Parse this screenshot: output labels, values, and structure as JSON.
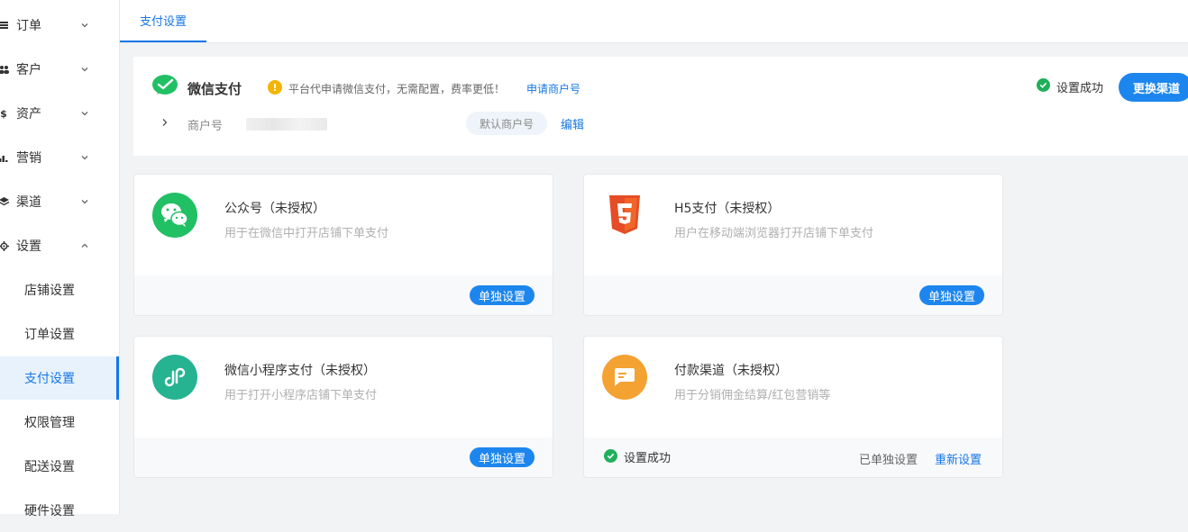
{
  "sidebar": {
    "groups": [
      {
        "label": "订单",
        "icon": "list-icon"
      },
      {
        "label": "客户",
        "icon": "users-icon"
      },
      {
        "label": "资产",
        "icon": "dollar-icon"
      },
      {
        "label": "营销",
        "icon": "bar-chart-icon"
      },
      {
        "label": "渠道",
        "icon": "layers-icon"
      },
      {
        "label": "设置",
        "icon": "gear-icon"
      }
    ],
    "sub_items": [
      "店铺设置",
      "订单设置",
      "支付设置",
      "权限管理",
      "配送设置",
      "硬件设置"
    ],
    "active_sub": "支付设置"
  },
  "tabs": {
    "active": "支付设置"
  },
  "wechat_pay": {
    "title": "微信支付",
    "tip": "平台代申请微信支付，无需配置，费率更低！",
    "tip_link": "申请商户号",
    "status": "设置成功",
    "switch_button": "更换渠道",
    "merchant_label": "商户号",
    "default_badge": "默认商户号",
    "edit_link": "编辑"
  },
  "cards": [
    {
      "title": "公众号（未授权）",
      "desc": "用于在微信中打开店铺下单支付",
      "button": "单独设置",
      "icon": "wechat-icon",
      "color": "#21c064"
    },
    {
      "title": "H5支付（未授权）",
      "desc": "用户在移动端浏览器打开店铺下单支付",
      "button": "单独设置",
      "icon": "html5-icon",
      "color": "#e44d26"
    },
    {
      "title": "微信小程序支付（未授权）",
      "desc": "用于打开小程序店铺下单支付",
      "button": "单独设置",
      "icon": "mini-program-icon",
      "color": "#26b392"
    },
    {
      "title": "付款渠道（未授权）",
      "desc": "用于分销佣金结算/红包营销等",
      "status": "设置成功",
      "done": "已单独设置",
      "reset": "重新设置",
      "icon": "payment-channel-icon",
      "color": "#f4a232"
    }
  ],
  "colors": {
    "primary": "#1677e6",
    "success": "#20b05a",
    "warning": "#f5b400"
  }
}
